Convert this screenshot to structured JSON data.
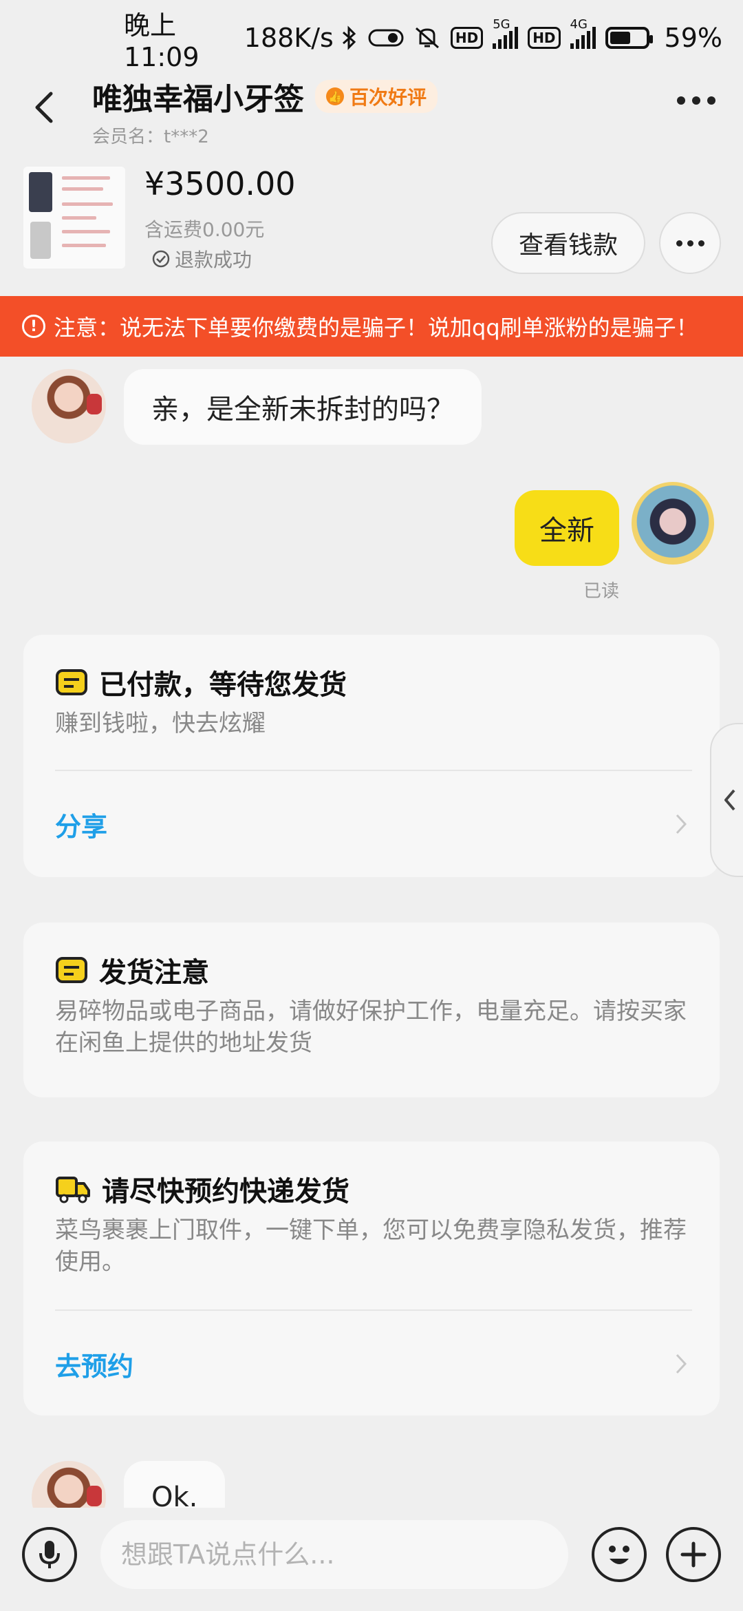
{
  "status_bar": {
    "time": "晚上11:09",
    "net_speed": "188K/s",
    "hd1": "HD",
    "sig1_label": "5G",
    "hd2": "HD",
    "sig2_label": "4G",
    "battery_level": 0.59,
    "battery_text": "59%"
  },
  "header": {
    "title": "唯独幸福小牙签",
    "badge": "百次好评",
    "member": "会员名：t***2"
  },
  "product": {
    "price": "¥3500.00",
    "shipping": "含运费0.00元",
    "refund_status": "退款成功",
    "view_payment_label": "查看钱款"
  },
  "warning": {
    "text": "注意：说无法下单要你缴费的是骗子！说加qq刷单涨粉的是骗子！"
  },
  "messages": [
    {
      "side": "left",
      "text": "亲，是全新未拆封的吗？"
    },
    {
      "side": "right",
      "text": "全新",
      "status": "已读"
    },
    {
      "side": "left",
      "text": "Ok."
    }
  ],
  "cards": [
    {
      "title": "已付款，等待您发货",
      "desc": "赚到钱啦，快去炫耀",
      "link": "分享",
      "icon": "box-icon"
    },
    {
      "title": "发货注意",
      "desc": "易碎物品或电子商品，请做好保护工作，电量充足。请按买家在闲鱼上提供的地址发货",
      "icon": "box-icon"
    },
    {
      "title": "请尽快预约快递发货",
      "desc": "菜鸟裹裹上门取件，一键下单，您可以免费享隐私发货，推荐使用。",
      "link": "去预约",
      "icon": "truck-icon"
    }
  ],
  "input": {
    "placeholder": "想跟TA说点什么..."
  },
  "colors": {
    "warning_bg": "#f34f28",
    "my_bubble": "#f7dd17",
    "link": "#1f9fe8",
    "badge_text": "#f07a14"
  }
}
